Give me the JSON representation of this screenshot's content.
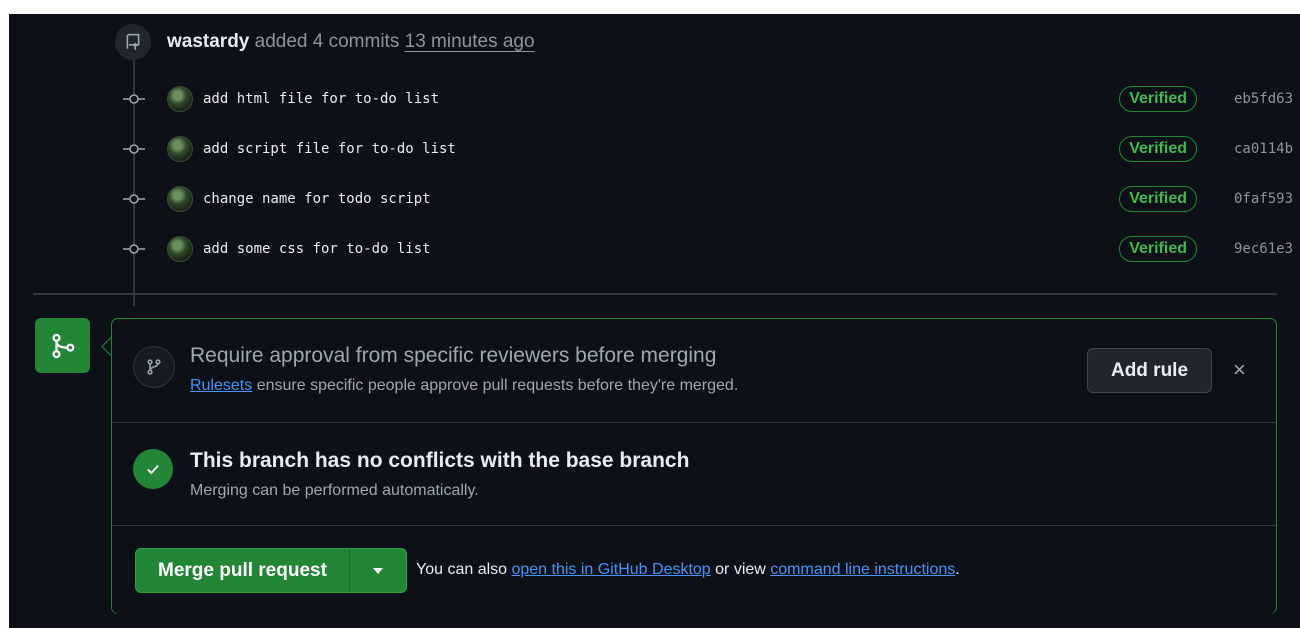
{
  "push": {
    "actor": "wastardy",
    "action": " added 4 commits ",
    "time": "13 minutes ago"
  },
  "commits": [
    {
      "message": "add html file for to-do list",
      "badge": "Verified",
      "sha": "eb5fd63"
    },
    {
      "message": "add script file for to-do list",
      "badge": "Verified",
      "sha": "ca0114b"
    },
    {
      "message": "change name for todo script",
      "badge": "Verified",
      "sha": "0faf593"
    },
    {
      "message": "add some css for to-do list",
      "badge": "Verified",
      "sha": "9ec61e3"
    }
  ],
  "ruleset_prompt": {
    "title": "Require approval from specific reviewers before merging",
    "link": "Rulesets",
    "description": " ensure specific people approve pull requests before they're merged.",
    "add_button": "Add rule",
    "close_glyph": "×"
  },
  "conflicts": {
    "title": "This branch has no conflicts with the base branch",
    "description": "Merging can be performed automatically."
  },
  "merge": {
    "button": "Merge pull request",
    "also_prefix": "You can also ",
    "desktop_link": "open this in GitHub Desktop",
    "middle": " or view ",
    "cli_link": "command line instructions",
    "suffix": "."
  },
  "colors": {
    "background": "#0d1117",
    "accent_green": "#238636",
    "link_blue": "#4493f8"
  },
  "icons": {
    "push": "repo-push-icon",
    "commit": "git-commit-icon",
    "merge": "git-merge-icon",
    "ruleset": "git-branch-icon",
    "check": "check-icon",
    "caret": "triangle-down-icon",
    "close": "x-icon"
  }
}
